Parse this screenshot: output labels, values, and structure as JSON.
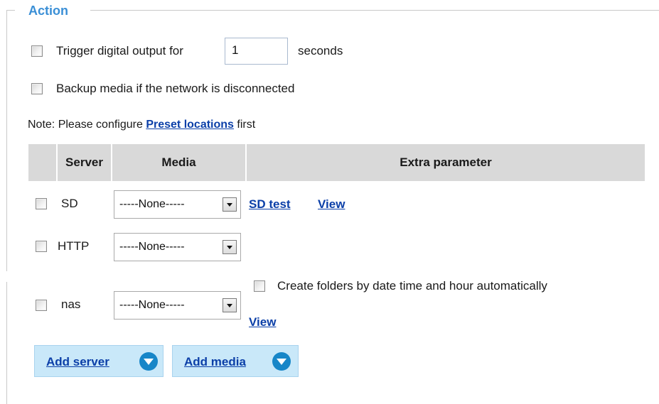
{
  "section": {
    "legend": "Action"
  },
  "options": {
    "trigger_label": "Trigger digital output for",
    "trigger_value": "1",
    "trigger_unit": "seconds",
    "backup_label": "Backup media if the network is disconnected"
  },
  "note": {
    "prefix": "Note: Please configure",
    "link": "Preset locations",
    "suffix": "first"
  },
  "table": {
    "headers": [
      "Server",
      "Media",
      "Extra parameter"
    ],
    "rows": [
      {
        "server": "SD",
        "media": "-----None-----",
        "links": [
          "SD test",
          "View"
        ]
      },
      {
        "server": "HTTP",
        "media": "-----None-----"
      },
      {
        "server": "nas",
        "media": "-----None-----",
        "extra_checkbox_label": "Create folders by date time and hour automatically",
        "links": [
          "View"
        ]
      }
    ]
  },
  "buttons": {
    "add_server": "Add server",
    "add_media": "Add media"
  },
  "colors": {
    "legend": "#3a8fd6",
    "link": "#0b3fa8",
    "header_bg": "#d9d9d9",
    "button_bg": "#c9e8f9",
    "button_icon": "#1786c8"
  },
  "icons": {
    "add_button_icon": "chevron-down-circle-icon"
  }
}
